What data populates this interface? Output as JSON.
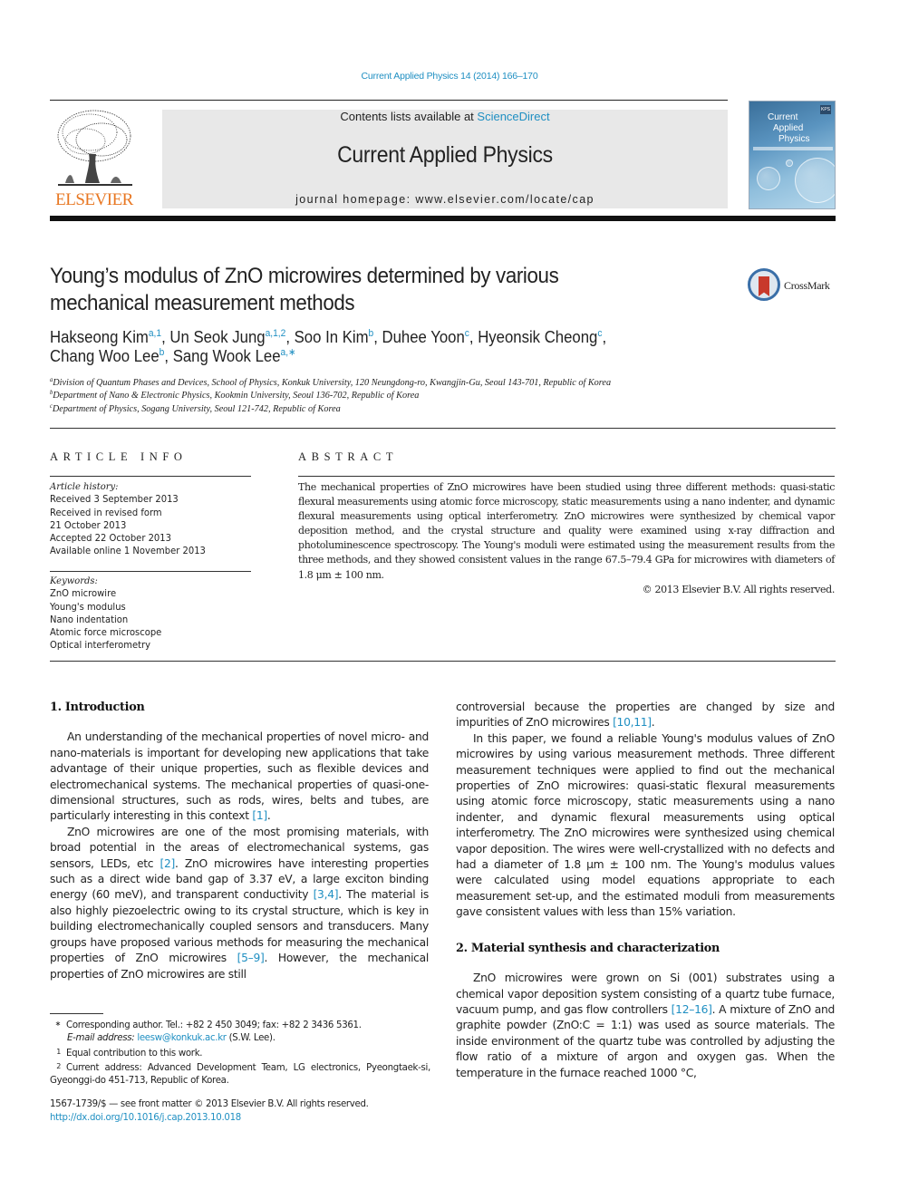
{
  "header": {
    "citation": "Current Applied Physics 14 (2014) 166–170",
    "publisher_logo_text": "ELSEVIER",
    "contents_prefix": "Contents lists available at ",
    "contents_link": "ScienceDirect",
    "journal_name": "Current Applied Physics",
    "homepage": "journal homepage: www.elsevier.com/locate/cap",
    "cover": {
      "title_lines": [
        "Current",
        "Applied",
        "Physics"
      ],
      "badge": "KPS"
    },
    "colors": {
      "link": "#1f8fc2",
      "elsevier_orange": "#e87722",
      "banner_bg": "#e8e8e8"
    }
  },
  "article": {
    "title_line1": "Young’s modulus of ZnO microwires determined by various",
    "title_line2": "mechanical measurement methods",
    "crossmark_label": "CrossMark",
    "authors": [
      {
        "name": "Hakseong Kim",
        "sup": "a,1",
        "sep": ", "
      },
      {
        "name": "Un Seok Jung",
        "sup": "a,1,2",
        "sep": ", "
      },
      {
        "name": "Soo In Kim",
        "sup": "b",
        "sep": ", "
      },
      {
        "name": "Duhee Yoon",
        "sup": "c",
        "sep": ", "
      },
      {
        "name": "Hyeonsik Cheong",
        "sup": "c",
        "sep": ","
      },
      {
        "name": "Chang Woo Lee",
        "sup": "b",
        "sep": ", "
      },
      {
        "name": "Sang Wook Lee",
        "sup": "a,∗",
        "sep": ""
      }
    ],
    "affiliations": [
      {
        "sup": "a",
        "text": "Division of Quantum Phases and Devices, School of Physics, Konkuk University, 120 Neungdong-ro, Kwangjin-Gu, Seoul 143-701, Republic of Korea"
      },
      {
        "sup": "b",
        "text": "Department of Nano & Electronic Physics, Kookmin University, Seoul 136-702, Republic of Korea"
      },
      {
        "sup": "c",
        "text": "Department of Physics, Sogang University, Seoul 121-742, Republic of Korea"
      }
    ]
  },
  "article_info": {
    "heading": "ARTICLE INFO",
    "history_label": "Article history:",
    "history": [
      "Received 3 September 2013",
      "Received in revised form",
      "21 October 2013",
      "Accepted 22 October 2013",
      "Available online 1 November 2013"
    ],
    "keywords_label": "Keywords:",
    "keywords": [
      "ZnO microwire",
      "Young's modulus",
      "Nano indentation",
      "Atomic force microscope",
      "Optical interferometry"
    ]
  },
  "abstract": {
    "heading": "ABSTRACT",
    "text": "The mechanical properties of ZnO microwires have been studied using three different methods: quasi-static flexural measurements using atomic force microscopy, static measurements using a nano indenter, and dynamic flexural measurements using optical interferometry. ZnO microwires were synthesized by chemical vapor deposition method, and the crystal structure and quality were examined using x-ray diffraction and photoluminescence spectroscopy. The Young's moduli were estimated using the measurement results from the three methods, and they showed consistent values in the range 67.5–79.4 GPa for microwires with diameters of 1.8 μm ± 100 nm.",
    "copyright": "© 2013 Elsevier B.V. All rights reserved."
  },
  "body": {
    "section1_heading": "1.  Introduction",
    "s1_p1": {
      "text": "An understanding of the mechanical properties of novel micro- and nano-materials is important for developing new applications that take advantage of their unique properties, such as flexible devices and electromechanical systems. The mechanical properties of quasi-one-dimensional structures, such as rods, wires, belts and tubes, are particularly interesting in this context ",
      "ref1": "[1]",
      "end": "."
    },
    "s1_p2": {
      "a": "ZnO microwires are one of the most promising materials, with broad potential in the areas of electromechanical systems, gas sensors, LEDs, etc ",
      "ref_a": "[2]",
      "b": ". ZnO microwires have interesting properties such as a direct wide band gap of 3.37 eV, a large exciton binding energy (60 meV), and transparent conductivity ",
      "ref_b": "[3,4]",
      "c": ". The material is also highly piezoelectric owing to its crystal structure, which is key in building electromechanically coupled sensors and transducers. Many groups have proposed various methods for measuring the mechanical properties of ZnO microwires ",
      "ref_c": "[5–9]",
      "d": ". However, the mechanical properties of ZnO microwires are still controversial because the properties are changed by size and impurities of ZnO microwires ",
      "ref_d": "[10,11]",
      "e": "."
    },
    "s1_p3": "In this paper, we found a reliable Young's modulus values of ZnO microwires by using various measurement methods. Three different measurement techniques were applied to find out the mechanical properties of ZnO microwires: quasi-static flexural measurements using atomic force microscopy, static measurements using a nano indenter, and dynamic flexural measurements using optical interferometry. The ZnO microwires were synthesized using chemical vapor deposition. The wires were well-crystallized with no defects and had a diameter of 1.8 μm ± 100 nm. The Young's modulus values were calculated using model equations appropriate to each measurement set-up, and the estimated moduli from measurements gave consistent values with less than 15% variation.",
    "section2_heading": "2.  Material synthesis and characterization",
    "s2_p1": {
      "a": "ZnO microwires were grown on Si (001) substrates using a chemical vapor deposition system consisting of a quartz tube furnace, vacuum pump, and gas flow controllers ",
      "ref_a": "[12–16]",
      "b": ". A mixture of ZnO and graphite powder (ZnO:C = 1:1) was used as source materials. The inside environment of the quartz tube was controlled by adjusting the flow ratio of a mixture of argon and oxygen gas. When the temperature in the furnace reached 1000 °C,"
    }
  },
  "footnotes": {
    "corresponding_sym": "∗",
    "corresponding": "Corresponding author. Tel.: +82 2 450 3049; fax: +82 2 3436 5361.",
    "email_label": "E-mail address: ",
    "email": "leesw@konkuk.ac.kr",
    "email_suffix": " (S.W. Lee).",
    "fn1_sym": "1",
    "fn1": "Equal contribution to this work.",
    "fn2_sym": "2",
    "fn2": "Current address: Advanced Development Team, LG electronics, Pyeongtaek-si, Gyeonggi-do 451-713, Republic of Korea.",
    "issn_line": "1567-1739/$ — see front matter © 2013 Elsevier B.V. All rights reserved.",
    "doi": "http://dx.doi.org/10.1016/j.cap.2013.10.018"
  }
}
